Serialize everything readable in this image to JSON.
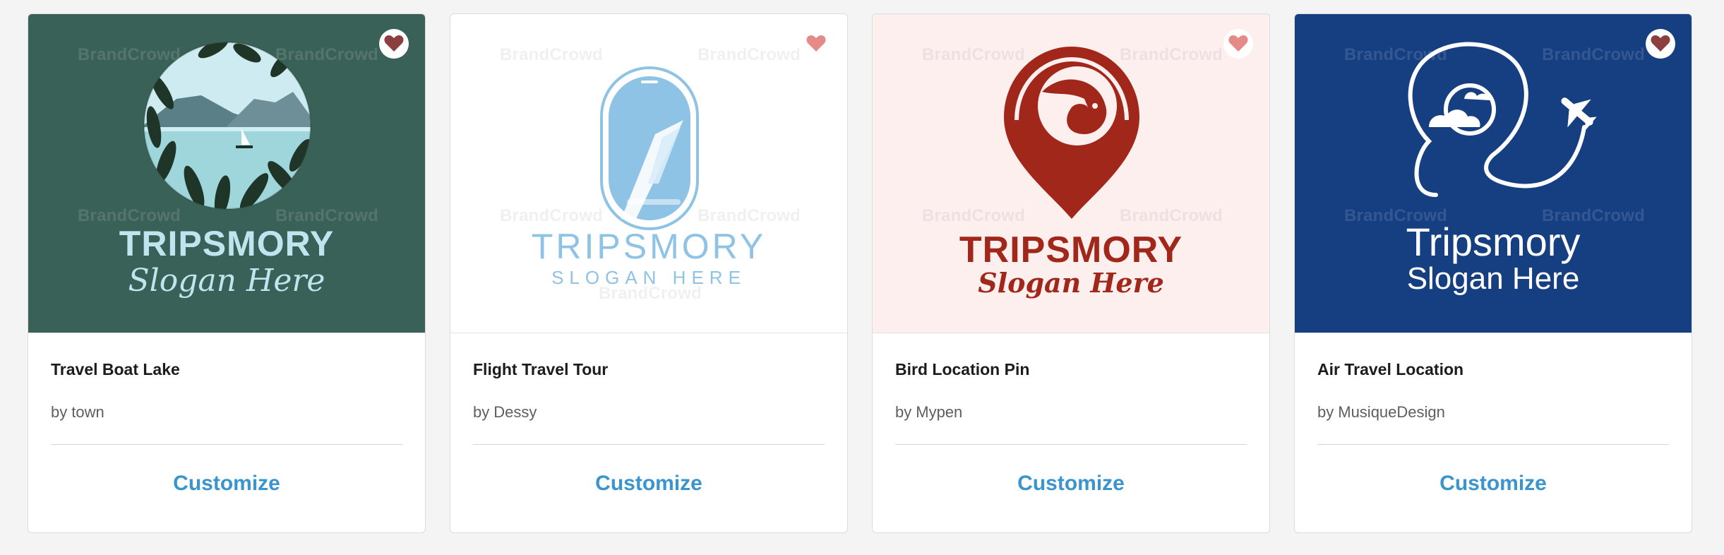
{
  "watermark": "BrandCrowd",
  "cards": [
    {
      "title": "Travel Boat Lake",
      "by": "by",
      "author": "town",
      "cta": "Customize",
      "logo": {
        "brand": "TRIPSMORY",
        "slogan": "Slogan Here"
      },
      "colors": {
        "background": "#3a6158",
        "brand": "#bfe6ef",
        "heart_bg": "#ffffff",
        "heart": "#8b3f3f"
      }
    },
    {
      "title": "Flight Travel Tour",
      "by": "by",
      "author": "Dessy",
      "cta": "Customize",
      "logo": {
        "brand": "TRIPSMORY",
        "slogan": "SLOGAN HERE"
      },
      "colors": {
        "background": "#ffffff",
        "brand": "#8fc3e6",
        "heart": "#e58a86"
      }
    },
    {
      "title": "Bird Location Pin",
      "by": "by",
      "author": "Mypen",
      "cta": "Customize",
      "logo": {
        "brand": "TRIPSMORY",
        "slogan": "Slogan Here"
      },
      "colors": {
        "background": "#fcefee",
        "brand": "#a2271b",
        "heart_bg": "#ffffff",
        "heart": "#e58a86"
      }
    },
    {
      "title": "Air Travel Location",
      "by": "by",
      "author": "MusiqueDesign",
      "cta": "Customize",
      "logo": {
        "brand": "Tripsmory",
        "slogan": "Slogan Here"
      },
      "colors": {
        "background": "#163f82",
        "brand": "#ffffff",
        "heart_bg": "#ffffff",
        "heart": "#8b3f3f"
      }
    }
  ]
}
